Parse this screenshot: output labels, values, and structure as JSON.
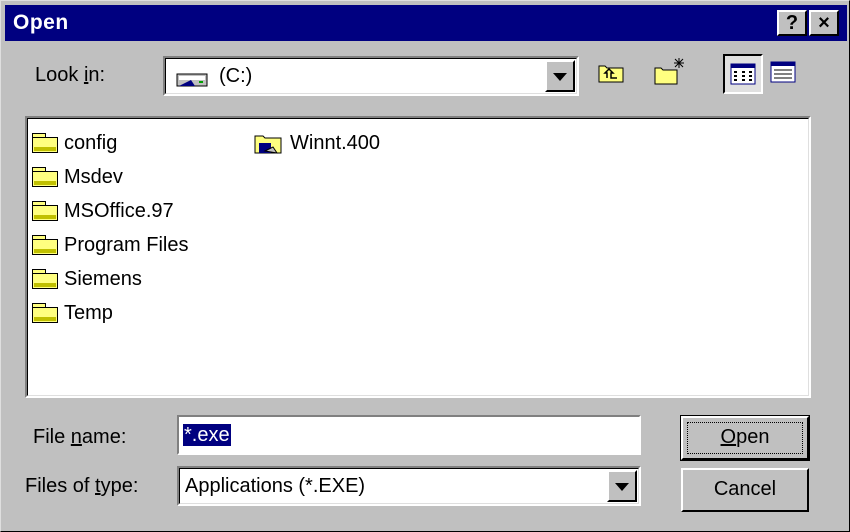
{
  "window": {
    "title": "Open"
  },
  "titlebar": {
    "help_label": "?",
    "close_label": "×"
  },
  "lookin": {
    "label_pre": "Look ",
    "label_accel": "i",
    "label_post": "n:",
    "value": "(C:)"
  },
  "files": [
    {
      "name": "config",
      "icon": "folder-icon"
    },
    {
      "name": "Msdev",
      "icon": "folder-icon"
    },
    {
      "name": "MSOffice.97",
      "icon": "folder-icon"
    },
    {
      "name": "Program Files",
      "icon": "folder-icon"
    },
    {
      "name": "Siemens",
      "icon": "folder-icon"
    },
    {
      "name": "Temp",
      "icon": "folder-icon"
    },
    {
      "name": "Winnt.400",
      "icon": "system-folder-icon"
    }
  ],
  "filename": {
    "label_pre": "File ",
    "label_accel": "n",
    "label_post": "ame:",
    "value": "*.exe"
  },
  "filetype": {
    "label_pre": "Files of ",
    "label_accel": "t",
    "label_post": "ype:",
    "value": "Applications (*.EXE)"
  },
  "buttons": {
    "open_accel": "O",
    "open_rest": "pen",
    "cancel_label": "Cancel"
  }
}
